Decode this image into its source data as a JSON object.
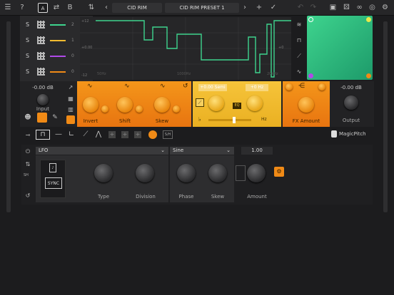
{
  "toolbar": {
    "preset_category": "CID RIM",
    "preset_name": "CID RIM PRESET 1",
    "slot_a": "A",
    "slot_b": "B",
    "help": "?"
  },
  "rows": [
    {
      "s": "S",
      "num": "2"
    },
    {
      "s": "S",
      "num": "1"
    },
    {
      "s": "S",
      "num": "0"
    },
    {
      "s": "S",
      "num": "0"
    }
  ],
  "graph": {
    "left_top": "+12",
    "left_mid": "+0.00",
    "left_bot": "-12",
    "right_mid": "+0",
    "freq_lo": "50Hz",
    "freq_mid": "1000Hz",
    "freq_hi": "20kHz"
  },
  "input": {
    "db": "-0.00 dB",
    "label": "Input"
  },
  "output": {
    "db": "-0.00 dB",
    "label": "Output"
  },
  "orange_section": {
    "invert": "Invert",
    "shift": "Shift",
    "skew": "Skew"
  },
  "yellow_section": {
    "semi": "+0.00 Semi",
    "hz": "+0 Hz",
    "eq": "EQ",
    "hz_unit": "Hz"
  },
  "fx": {
    "label": "FX Amount"
  },
  "brand": "MagicPitch",
  "mod": {
    "source": "LFO",
    "wave": "Sine",
    "value": "1.00",
    "sync": "SYNC",
    "type": "Type",
    "division": "Division",
    "phase": "Phase",
    "skew": "Skew",
    "amount": "Amount",
    "sh": "S/H",
    "sh_left": "SH"
  },
  "colors": {
    "accent": "#f08a16",
    "green": "#3ed48e",
    "yellow": "#f2bc30"
  }
}
